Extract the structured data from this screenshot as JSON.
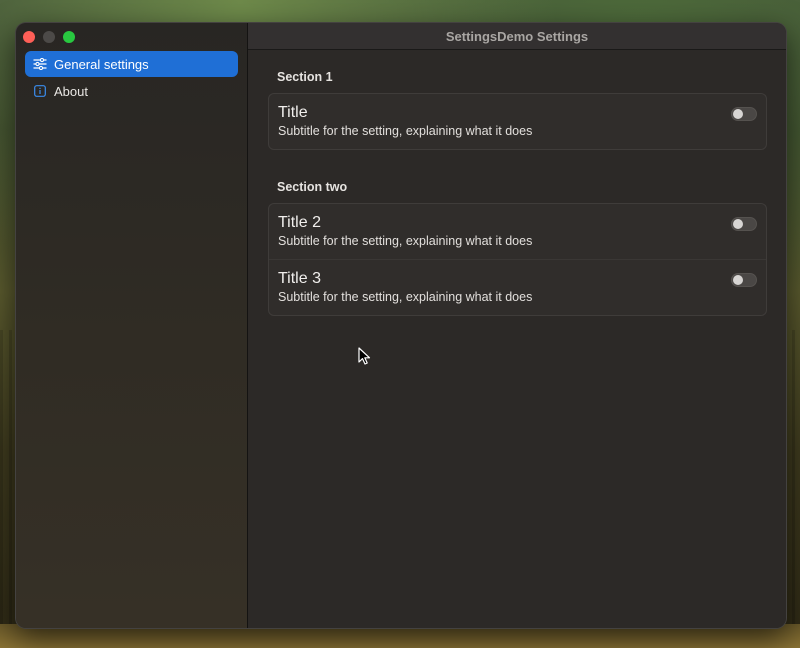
{
  "window": {
    "title": "SettingsDemo Settings"
  },
  "sidebar": {
    "items": [
      {
        "label": "General settings",
        "icon": "sliders-icon",
        "selected": true
      },
      {
        "label": "About",
        "icon": "info-icon",
        "selected": false
      }
    ]
  },
  "sections": [
    {
      "title": "Section 1",
      "rows": [
        {
          "title": "Title",
          "subtitle": "Subtitle for the setting, explaining what it does",
          "on": false
        }
      ]
    },
    {
      "title": "Section two",
      "rows": [
        {
          "title": "Title 2",
          "subtitle": "Subtitle for the setting, explaining what it does",
          "on": false
        },
        {
          "title": "Title 3",
          "subtitle": "Subtitle for the setting, explaining what it does",
          "on": false
        }
      ]
    }
  ],
  "colors": {
    "accent": "#1f6fd6",
    "close": "#fe5f57",
    "zoom": "#28c840"
  }
}
